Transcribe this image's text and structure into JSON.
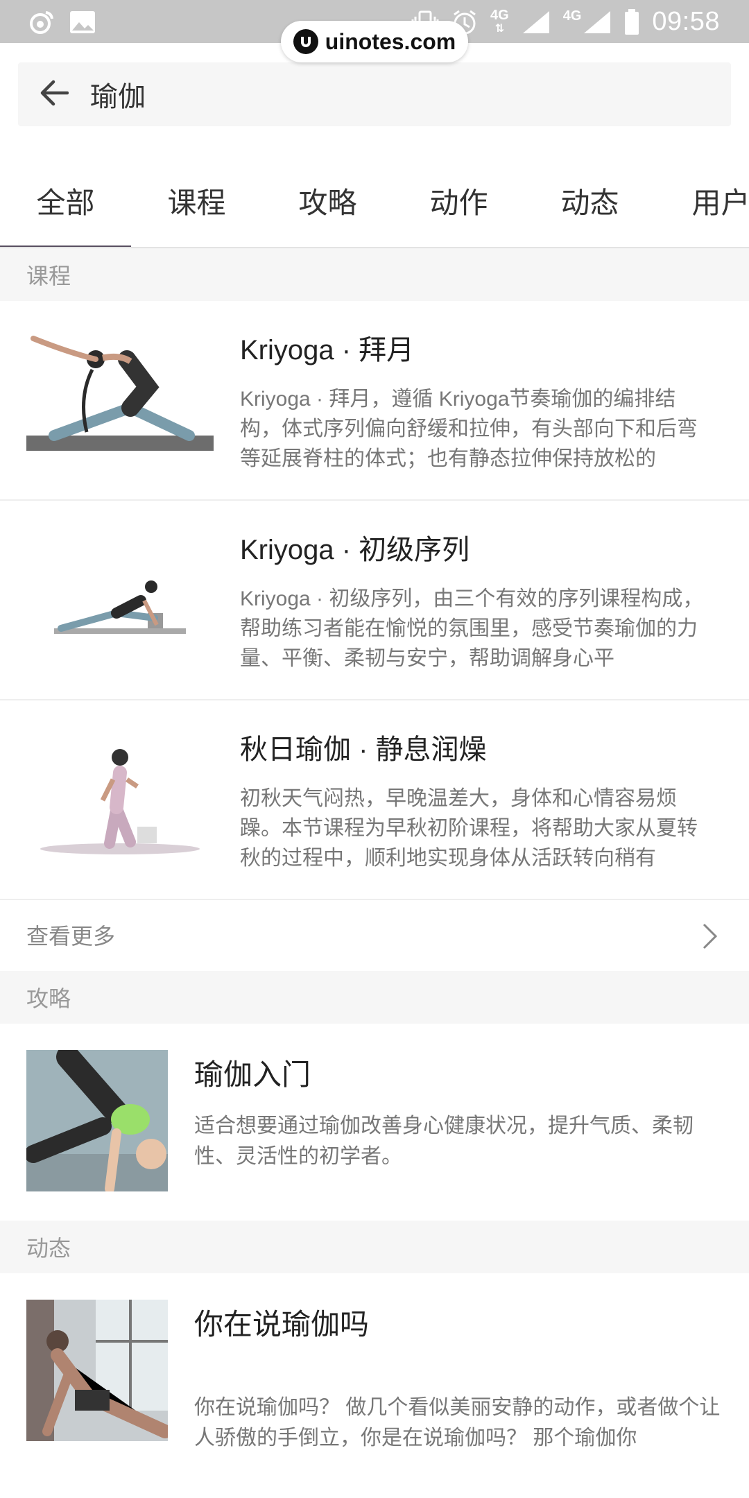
{
  "status_bar": {
    "time": "09:58",
    "network_1": "4G",
    "network_2": "4G",
    "icons": [
      "weibo-icon",
      "gallery-icon",
      "vibrate-icon",
      "alarm-icon",
      "signal-icon",
      "signal-icon",
      "battery-icon"
    ]
  },
  "watermark": {
    "text": "uinotes.com"
  },
  "header": {
    "title": "瑜伽",
    "back_icon": "arrow-left-icon"
  },
  "tabs": [
    {
      "label": "全部",
      "active": true
    },
    {
      "label": "课程",
      "active": false
    },
    {
      "label": "攻略",
      "active": false
    },
    {
      "label": "动作",
      "active": false
    },
    {
      "label": "动态",
      "active": false
    },
    {
      "label": "用户",
      "active": false
    }
  ],
  "sections": {
    "courses_label": "课程",
    "guides_label": "攻略",
    "moments_label": "动态"
  },
  "courses": [
    {
      "title": "Kriyoga · 拜月",
      "desc": "Kriyoga · 拜月，遵循 Kriyoga节奏瑜伽的编排结构，体式序列偏向舒缓和拉伸，有头部向下和后弯等延展脊柱的体式；也有静态拉伸保持放松的"
    },
    {
      "title": "Kriyoga · 初级序列",
      "desc": "Kriyoga · 初级序列，由三个有效的序列课程构成，帮助练习者能在愉悦的氛围里，感受节奏瑜伽的力量、平衡、柔韧与安宁，帮助调解身心平"
    },
    {
      "title": "秋日瑜伽 · 静息润燥",
      "desc": "初秋天气闷热，早晚温差大，身体和心情容易烦躁。本节课程为早秋初阶课程，将帮助大家从夏转秋的过程中，顺利地实现身体从活跃转向稍有"
    }
  ],
  "see_more": "查看更多",
  "guides": [
    {
      "title": "瑜伽入门",
      "desc": "适合想要通过瑜伽改善身心健康状况，提升气质、柔韧性、灵活性的初学者。"
    }
  ],
  "moments": [
    {
      "title": "你在说瑜伽吗",
      "desc": "你在说瑜伽吗？ 做几个看似美丽安静的动作，或者做个让人骄傲的手倒立，你是在说瑜伽吗？ 那个瑜伽你"
    }
  ],
  "colors": {
    "status_bar": "#c6c6c6",
    "tab_indicator": "#584f60",
    "section_bg": "#f6f6f6",
    "desc_text": "#777777"
  }
}
